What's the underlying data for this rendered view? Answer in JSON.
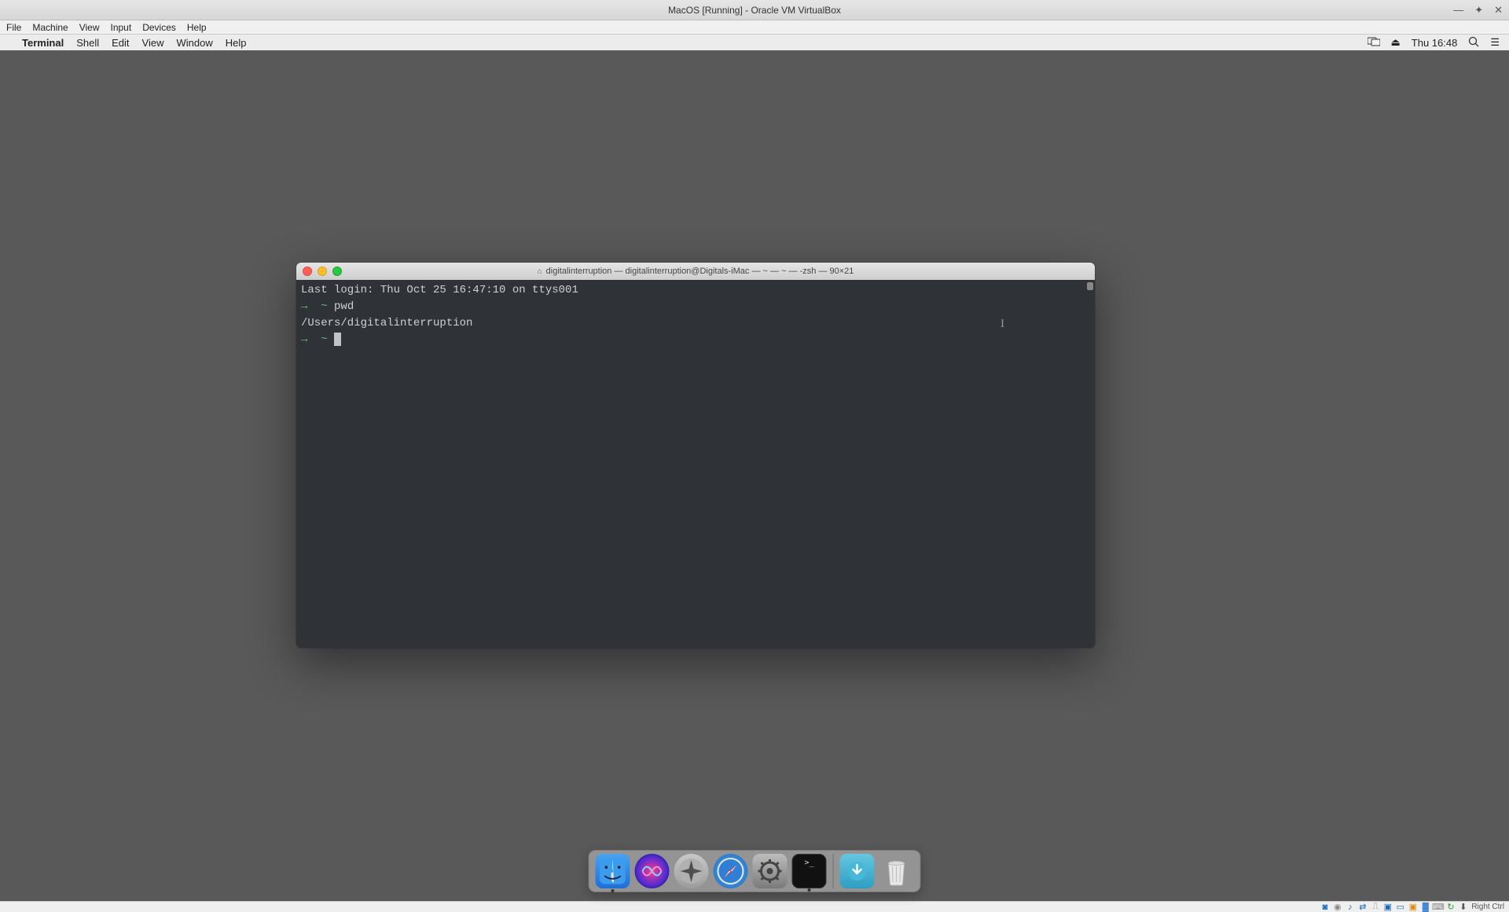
{
  "vb_titlebar": {
    "title": "MacOS [Running] - Oracle VM VirtualBox"
  },
  "vb_menubar": {
    "file": "File",
    "machine": "Machine",
    "view": "View",
    "input": "Input",
    "devices": "Devices",
    "help": "Help"
  },
  "mac_menubar": {
    "app": "Terminal",
    "shell": "Shell",
    "edit": "Edit",
    "view": "View",
    "window": "Window",
    "help": "Help",
    "clock": "Thu 16:48"
  },
  "terminal": {
    "title": "digitalinterruption — digitalinterruption@Digitals-iMac — ~ — ~ — -zsh — 90×21",
    "last_login": "Last login: Thu Oct 25 16:47:10 on ttys001",
    "arrow": "→",
    "tilde": "~",
    "cmd1": "pwd",
    "output1": "/Users/digitalinterruption"
  },
  "vb_statusbar": {
    "hostkey": "Right Ctrl"
  }
}
